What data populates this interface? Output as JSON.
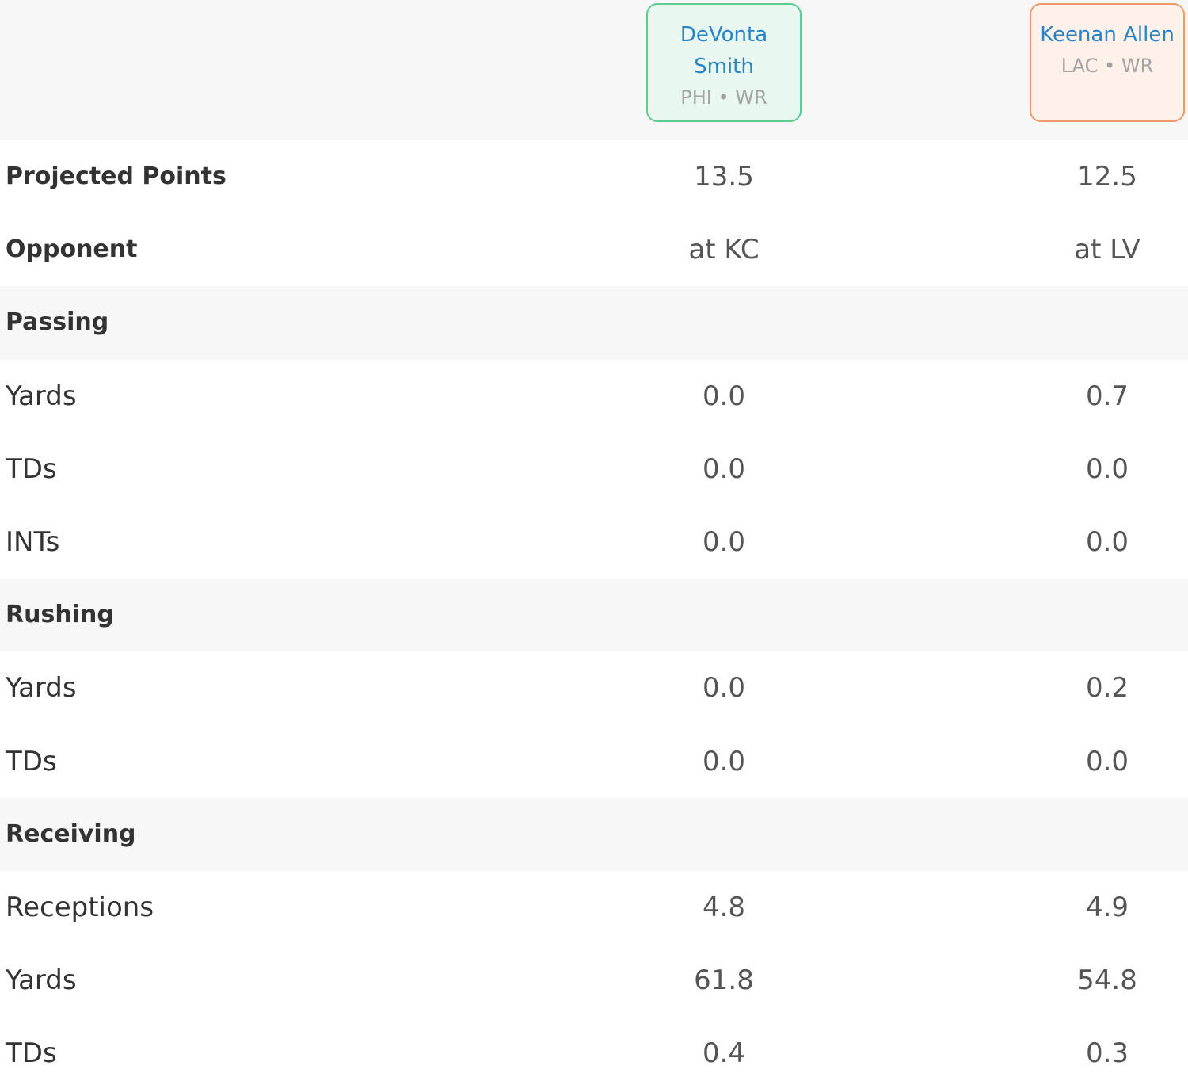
{
  "players": [
    {
      "name": "DeVonta Smith",
      "meta": "PHI • WR",
      "accent": "#5ccb8f",
      "bg": "#e8f7f0"
    },
    {
      "name": "Keenan Allen",
      "meta": "LAC • WR",
      "accent": "#f09a6b",
      "bg": "#fdf1ea"
    }
  ],
  "rows": [
    {
      "label": "Projected Points",
      "kind": "bold",
      "values": [
        "13.5",
        "12.5"
      ]
    },
    {
      "label": "Opponent",
      "kind": "bold",
      "values": [
        "at KC",
        "at LV"
      ]
    },
    {
      "label": "Passing",
      "kind": "section",
      "values": [
        "",
        ""
      ]
    },
    {
      "label": "Yards",
      "kind": "stat",
      "values": [
        "0.0",
        "0.7"
      ]
    },
    {
      "label": "TDs",
      "kind": "stat",
      "values": [
        "0.0",
        "0.0"
      ]
    },
    {
      "label": "INTs",
      "kind": "stat",
      "values": [
        "0.0",
        "0.0"
      ]
    },
    {
      "label": "Rushing",
      "kind": "section",
      "values": [
        "",
        ""
      ]
    },
    {
      "label": "Yards",
      "kind": "stat",
      "values": [
        "0.0",
        "0.2"
      ]
    },
    {
      "label": "TDs",
      "kind": "stat",
      "values": [
        "0.0",
        "0.0"
      ]
    },
    {
      "label": "Receiving",
      "kind": "section",
      "values": [
        "",
        ""
      ]
    },
    {
      "label": "Receptions",
      "kind": "stat",
      "values": [
        "4.8",
        "4.9"
      ]
    },
    {
      "label": "Yards",
      "kind": "stat",
      "values": [
        "61.8",
        "54.8"
      ]
    },
    {
      "label": "TDs",
      "kind": "stat",
      "values": [
        "0.4",
        "0.3"
      ]
    }
  ]
}
